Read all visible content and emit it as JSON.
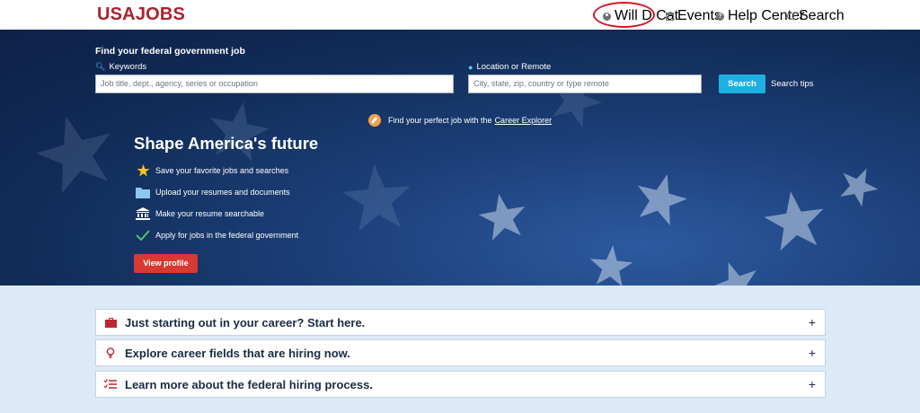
{
  "header": {
    "logo": "USAJOBS",
    "nav": {
      "user": "Will D Cat",
      "events": "Events",
      "help": "Help Center",
      "search": "Search"
    }
  },
  "search": {
    "title": "Find your federal government job",
    "keywords_label": "Keywords",
    "keywords_placeholder": "Job title, dept., agency, series or occupation",
    "location_label": "Location or Remote",
    "location_placeholder": "City, state, zip, country or type remote",
    "button": "Search",
    "tips": "Search tips"
  },
  "explorer": {
    "text": "Find your perfect job with the",
    "link": "Career Explorer"
  },
  "hero": {
    "title": "Shape America's future",
    "features": [
      {
        "icon": "star-icon",
        "text": "Save your favorite jobs and searches"
      },
      {
        "icon": "folder-icon",
        "text": "Upload your resumes and documents"
      },
      {
        "icon": "building-icon",
        "text": "Make your resume searchable"
      },
      {
        "icon": "check-icon",
        "text": "Apply for jobs in the federal government"
      }
    ],
    "button": "View profile"
  },
  "accordions": [
    {
      "icon": "briefcase-icon",
      "title": "Just starting out in your career? Start here."
    },
    {
      "icon": "lightbulb-icon",
      "title": "Explore career fields that are hiring now."
    },
    {
      "icon": "checklist-icon",
      "title": "Learn more about the federal hiring process."
    }
  ],
  "colors": {
    "brand": "#a8232e",
    "accent": "#1fb0e3",
    "profile_button": "#d83933",
    "accordion_icon": "#c0262d"
  }
}
